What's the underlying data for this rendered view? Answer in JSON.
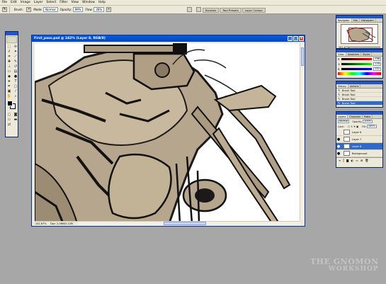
{
  "menu": [
    "File",
    "Edit",
    "Image",
    "Layer",
    "Select",
    "Filter",
    "View",
    "Window",
    "Help"
  ],
  "options_bar": {
    "brush_label": "Brush:",
    "mode_label": "Mode:",
    "mode_value": "Normal",
    "opacity_label": "Opacity:",
    "opacity_value": "99%",
    "flow_label": "Flow:",
    "flow_value": "36%"
  },
  "palette_wells": [
    "Brushes",
    "Tool Presets",
    "Layer Comps"
  ],
  "document": {
    "title": "First_pass.psd @ 242% (Layer 8, RGB/8)",
    "zoom": "241.67%",
    "doc_info": "Doc: 2.06M/3.12M"
  },
  "navigator": {
    "tabs": [
      "Navigator",
      "Info",
      "Histogram"
    ],
    "zoom": "241.67%"
  },
  "color_panel": {
    "tabs": [
      "Color",
      "Swatches",
      "Styles"
    ],
    "channels": [
      {
        "name": "R",
        "value": "196",
        "gradient": [
          "#000000",
          "#c4ad90"
        ]
      },
      {
        "name": "G",
        "value": "176",
        "gradient": [
          "#000000",
          "#c4b090"
        ]
      },
      {
        "name": "B",
        "value": "151",
        "gradient": [
          "#000000",
          "#c4ad97"
        ]
      }
    ]
  },
  "history": {
    "tabs": [
      "History",
      "Actions"
    ],
    "items": [
      {
        "label": "Brush Tool",
        "selected": false
      },
      {
        "label": "Brush Tool",
        "selected": false
      },
      {
        "label": "Brush Tool",
        "selected": false
      },
      {
        "label": "Brush Tool",
        "selected": true
      }
    ]
  },
  "layers": {
    "tabs": [
      "Layers",
      "Channels",
      "Paths"
    ],
    "blend_mode": "Normal",
    "opacity_label": "Opacity:",
    "opacity": "100%",
    "lock_label": "Lock:",
    "fill_label": "Fill:",
    "fill": "100%",
    "items": [
      {
        "name": "Layer 6",
        "visible": false,
        "selected": false
      },
      {
        "name": "Layer 7",
        "visible": true,
        "selected": false
      },
      {
        "name": "Layer 8",
        "visible": true,
        "selected": true
      },
      {
        "name": "Background",
        "visible": true,
        "selected": false
      }
    ]
  },
  "watermark": {
    "line1": "THE GNOMON",
    "line2": "WORKSHOP"
  },
  "colors": {
    "accent": "#316ac5",
    "title_bar": "#0a5bd8",
    "workspace": "#a7a7a7",
    "panel": "#ece9d8",
    "sketch_tone": "#b6a68d"
  }
}
